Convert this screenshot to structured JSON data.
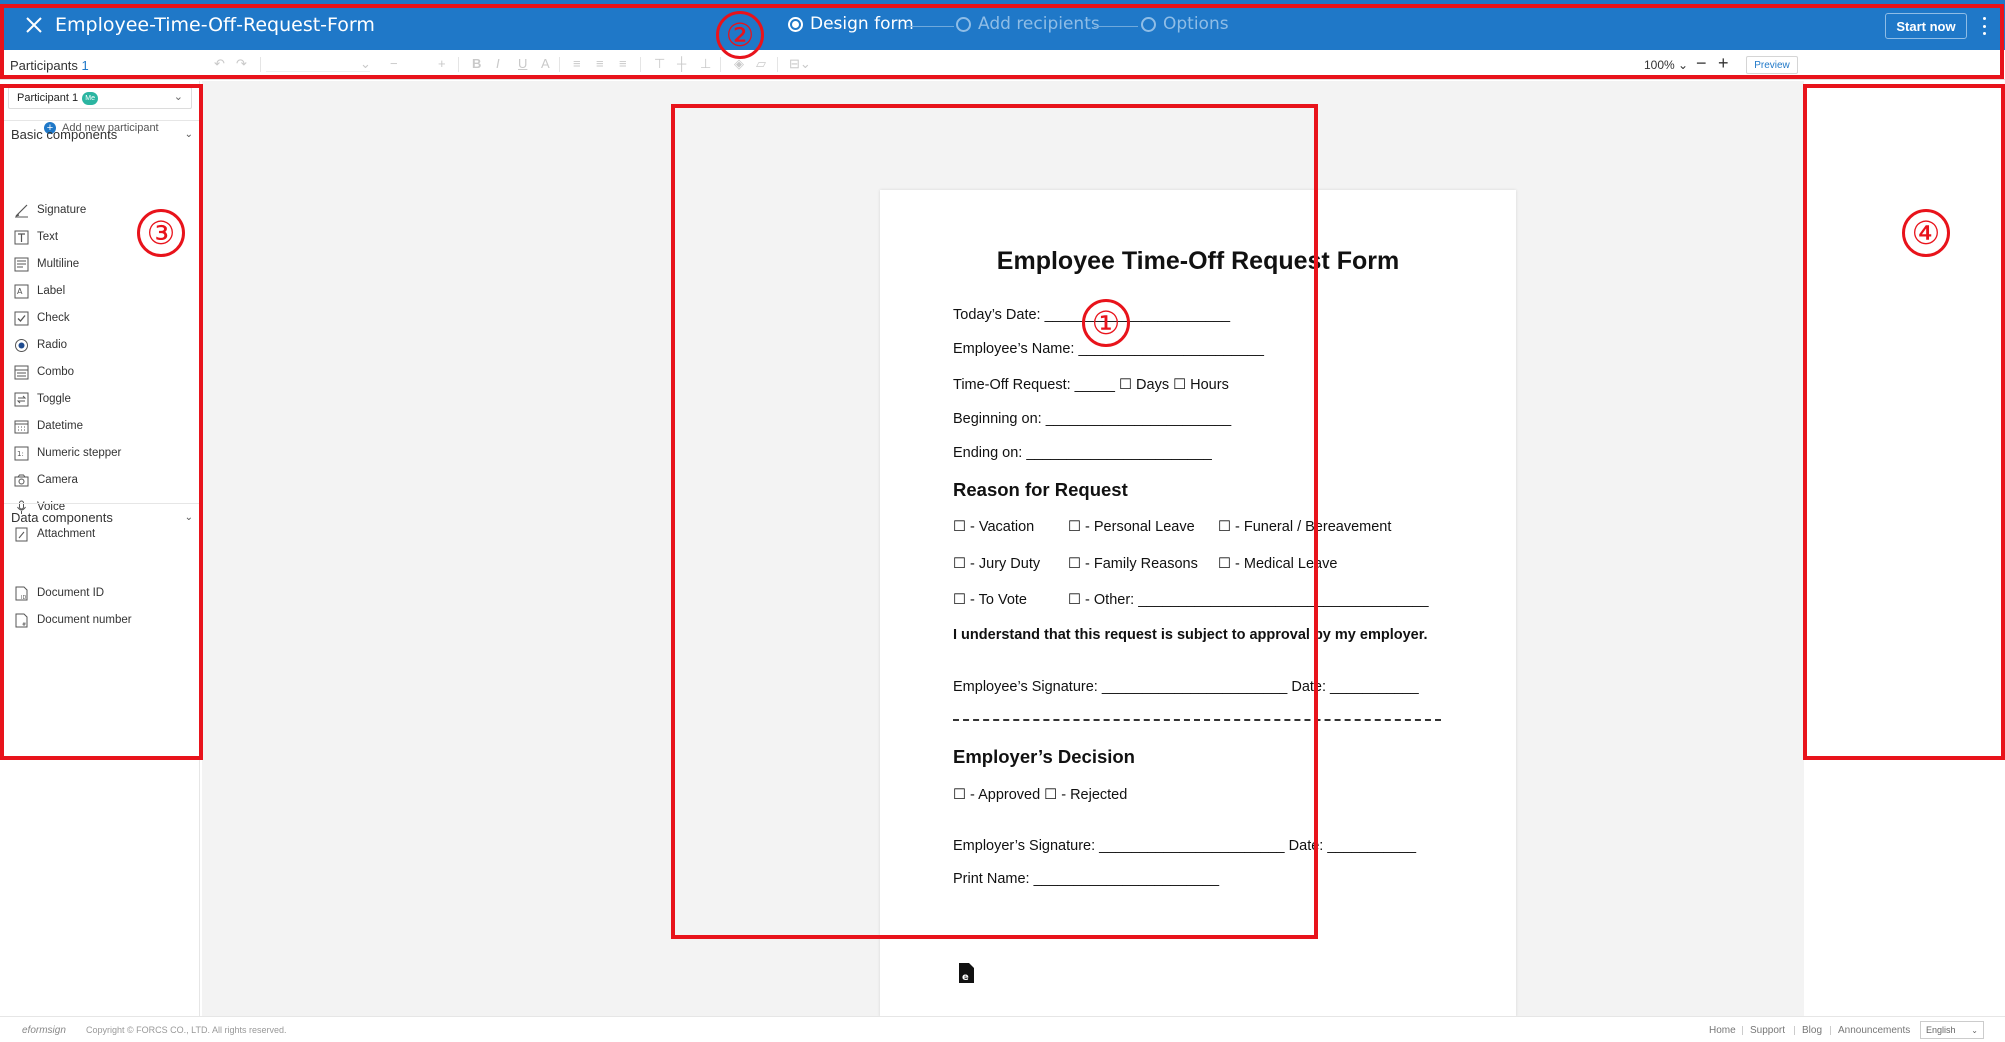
{
  "header": {
    "title": "Employee-Time-Off-Request-Form",
    "steps": [
      {
        "label": "Design form",
        "active": true
      },
      {
        "label": "Add recipients",
        "active": false
      },
      {
        "label": "Options",
        "active": false
      }
    ],
    "start_label": "Start now",
    "colors": {
      "bar": "#1f78c8",
      "annotation": "#e8131b"
    }
  },
  "toolbar": {
    "participants_label": "Participants",
    "participants_count": "1",
    "zoom": "100%",
    "preview_label": "Preview"
  },
  "left_panel": {
    "participant_selected": "Participant 1",
    "me_badge": "Me",
    "add_participant": "Add new participant",
    "basic_section": "Basic components",
    "basic_components": [
      {
        "label": "Signature",
        "icon": "signature-icon"
      },
      {
        "label": "Text",
        "icon": "text-icon"
      },
      {
        "label": "Multiline",
        "icon": "multiline-icon"
      },
      {
        "label": "Label",
        "icon": "label-icon"
      },
      {
        "label": "Check",
        "icon": "check-icon"
      },
      {
        "label": "Radio",
        "icon": "radio-icon"
      },
      {
        "label": "Combo",
        "icon": "combo-icon"
      },
      {
        "label": "Toggle",
        "icon": "toggle-icon"
      },
      {
        "label": "Datetime",
        "icon": "calendar-icon"
      },
      {
        "label": "Numeric stepper",
        "icon": "numeric-stepper-icon"
      },
      {
        "label": "Camera",
        "icon": "camera-icon"
      },
      {
        "label": "Voice",
        "icon": "microphone-icon"
      },
      {
        "label": "Attachment",
        "icon": "attachment-icon"
      }
    ],
    "data_section": "Data components",
    "data_components": [
      {
        "label": "Document ID",
        "icon": "document-id-icon"
      },
      {
        "label": "Document number",
        "icon": "document-number-icon"
      }
    ]
  },
  "document": {
    "title": "Employee Time-Off Request Form",
    "todays_date": "Today’s Date: _______________________",
    "employee_name": "Employee’s Name: _______________________",
    "time_off_request": "Time-Off Request: _____ ☐ Days  ☐ Hours",
    "beginning_on": "Beginning on: _______________________",
    "ending_on": "Ending on: _______________________",
    "reason_heading": "Reason for Request",
    "reason_row1": [
      "☐ - Vacation",
      "☐ - Personal Leave",
      "☐ - Funeral / Bereavement"
    ],
    "reason_row2": [
      "☐ - Jury Duty",
      "☐ - Family Reasons",
      "☐ - Medical Leave"
    ],
    "reason_row3": [
      "☐ - To Vote",
      "☐ - Other: ____________________________________"
    ],
    "understand": "I understand that this request is subject to approval by my employer.",
    "employee_signature": "Employee’s Signature: _______________________  Date: ___________",
    "decision_heading": "Employer’s Decision",
    "decision_options": "☐ - Approved ☐ - Rejected",
    "employer_signature": "Employer’s Signature: _______________________  Date: ___________",
    "print_name": "Print Name: _______________________"
  },
  "annotations": [
    "①",
    "②",
    "③",
    "④"
  ],
  "footer": {
    "brand": "eformsign",
    "copyright": "Copyright © FORCS CO., LTD. All rights reserved.",
    "links": [
      "Home",
      "Support",
      "Blog",
      "Announcements"
    ],
    "language": "English"
  }
}
